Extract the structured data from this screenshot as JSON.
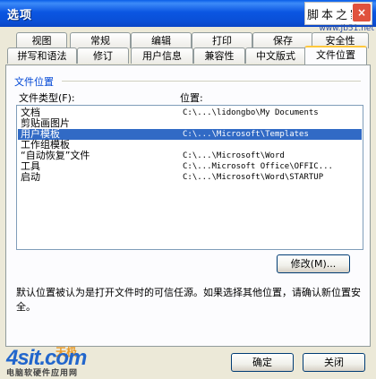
{
  "window": {
    "title": "选项"
  },
  "watermark": {
    "chars": "脚本之家",
    "close_glyph": "×",
    "url": "www.Jb51.net"
  },
  "tabs": {
    "row1": [
      "视图",
      "常规",
      "编辑",
      "打印",
      "保存",
      "安全性"
    ],
    "row2": [
      "拼写和语法",
      "修订",
      "用户信息",
      "兼容性",
      "中文版式",
      "文件位置"
    ],
    "active": "文件位置"
  },
  "panel": {
    "group_title": "文件位置",
    "col_type": "文件类型(F):",
    "col_location": "位置:",
    "items": [
      {
        "name": "文档",
        "path": "C:\\...\\lidongbo\\My Documents",
        "selected": false
      },
      {
        "name": "剪贴画图片",
        "path": "",
        "selected": false
      },
      {
        "name": "用户模板",
        "path": "C:\\...\\Microsoft\\Templates",
        "selected": true
      },
      {
        "name": "工作组模板",
        "path": "",
        "selected": false
      },
      {
        "name": "“自动恢复”文件",
        "path": "C:\\...\\Microsoft\\Word",
        "selected": false
      },
      {
        "name": "工具",
        "path": "C:\\...Microsoft Office\\OFFIC...",
        "selected": false
      },
      {
        "name": "启动",
        "path": "C:\\...\\Microsoft\\Word\\STARTUP",
        "selected": false
      }
    ],
    "modify_button": "修改(M)...",
    "note": "默认位置被认为是打开文件时的可信任源。如果选择其他位置，请确认新位置安全。"
  },
  "buttons": {
    "ok": "确定",
    "close": "关闭"
  },
  "logo": {
    "big": "4sit.com",
    "tag": "天极",
    "sub": "电脑软硬件应用网"
  }
}
